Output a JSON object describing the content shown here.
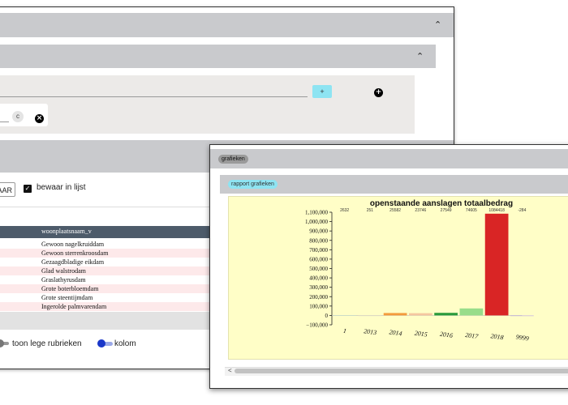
{
  "back_window": {
    "add_button_label": "+",
    "remove_icon_glyph": "×",
    "chip_icon_glyph": "c",
    "save_button_label": "AAR",
    "checkbox_checked": true,
    "checkbox_label": "bewaar in lijst",
    "table": {
      "column_header": "woonplaatsnaam_v",
      "rows": [
        "Gewoon nagelkruiddam",
        "Gewoon sterrenkroosdam",
        "Gezaagdbladige eikdam",
        "Glad walstrodam",
        "Graslathyrusdam",
        "Grote boterbloemdam",
        "Grote steentijmdam",
        "Ingerolde palmvarendam"
      ]
    },
    "toggles": [
      {
        "label": "toon lege rubrieken",
        "on": false
      },
      {
        "label": "kolom",
        "on": true
      }
    ],
    "colors": {
      "row_alt": "#fde9ea",
      "header": "#4d5b6a"
    }
  },
  "front_window": {
    "section_chip": "grafieken",
    "report_chip": "rapport grafieken",
    "scroll_left_glyph": "<"
  },
  "chart_data": {
    "type": "bar",
    "title": "openstaande aanslagen totaalbedrag",
    "xlabel": "",
    "ylabel": "",
    "categories": [
      "1",
      "2013",
      "2014",
      "2015",
      "2016",
      "2017",
      "2018",
      "9999"
    ],
    "values": [
      2632,
      251,
      25582,
      23746,
      27549,
      74605,
      1084418,
      -284
    ],
    "data_labels": [
      "2632",
      "251",
      "25582",
      "23746",
      "27549",
      "74605",
      "1084418",
      "-284"
    ],
    "colors": [
      "#c9dfc9",
      "#e8e3c6",
      "#f39b3c",
      "#f5c7a0",
      "#2a9a3b",
      "#98dd8a",
      "#d92525",
      "#c9b8e0"
    ],
    "ylim": [
      -100000,
      1100000
    ],
    "yticks": [
      -100000,
      0,
      100000,
      200000,
      300000,
      400000,
      500000,
      600000,
      700000,
      800000,
      900000,
      1000000,
      1100000
    ],
    "ytick_labels": [
      "−100,000",
      "0",
      "100,000",
      "200,000",
      "300,000",
      "400,000",
      "500,000",
      "600,000",
      "700,000",
      "800,000",
      "900,000",
      "1,000,000",
      "1,100,000"
    ],
    "grid": false,
    "legend": "none"
  }
}
